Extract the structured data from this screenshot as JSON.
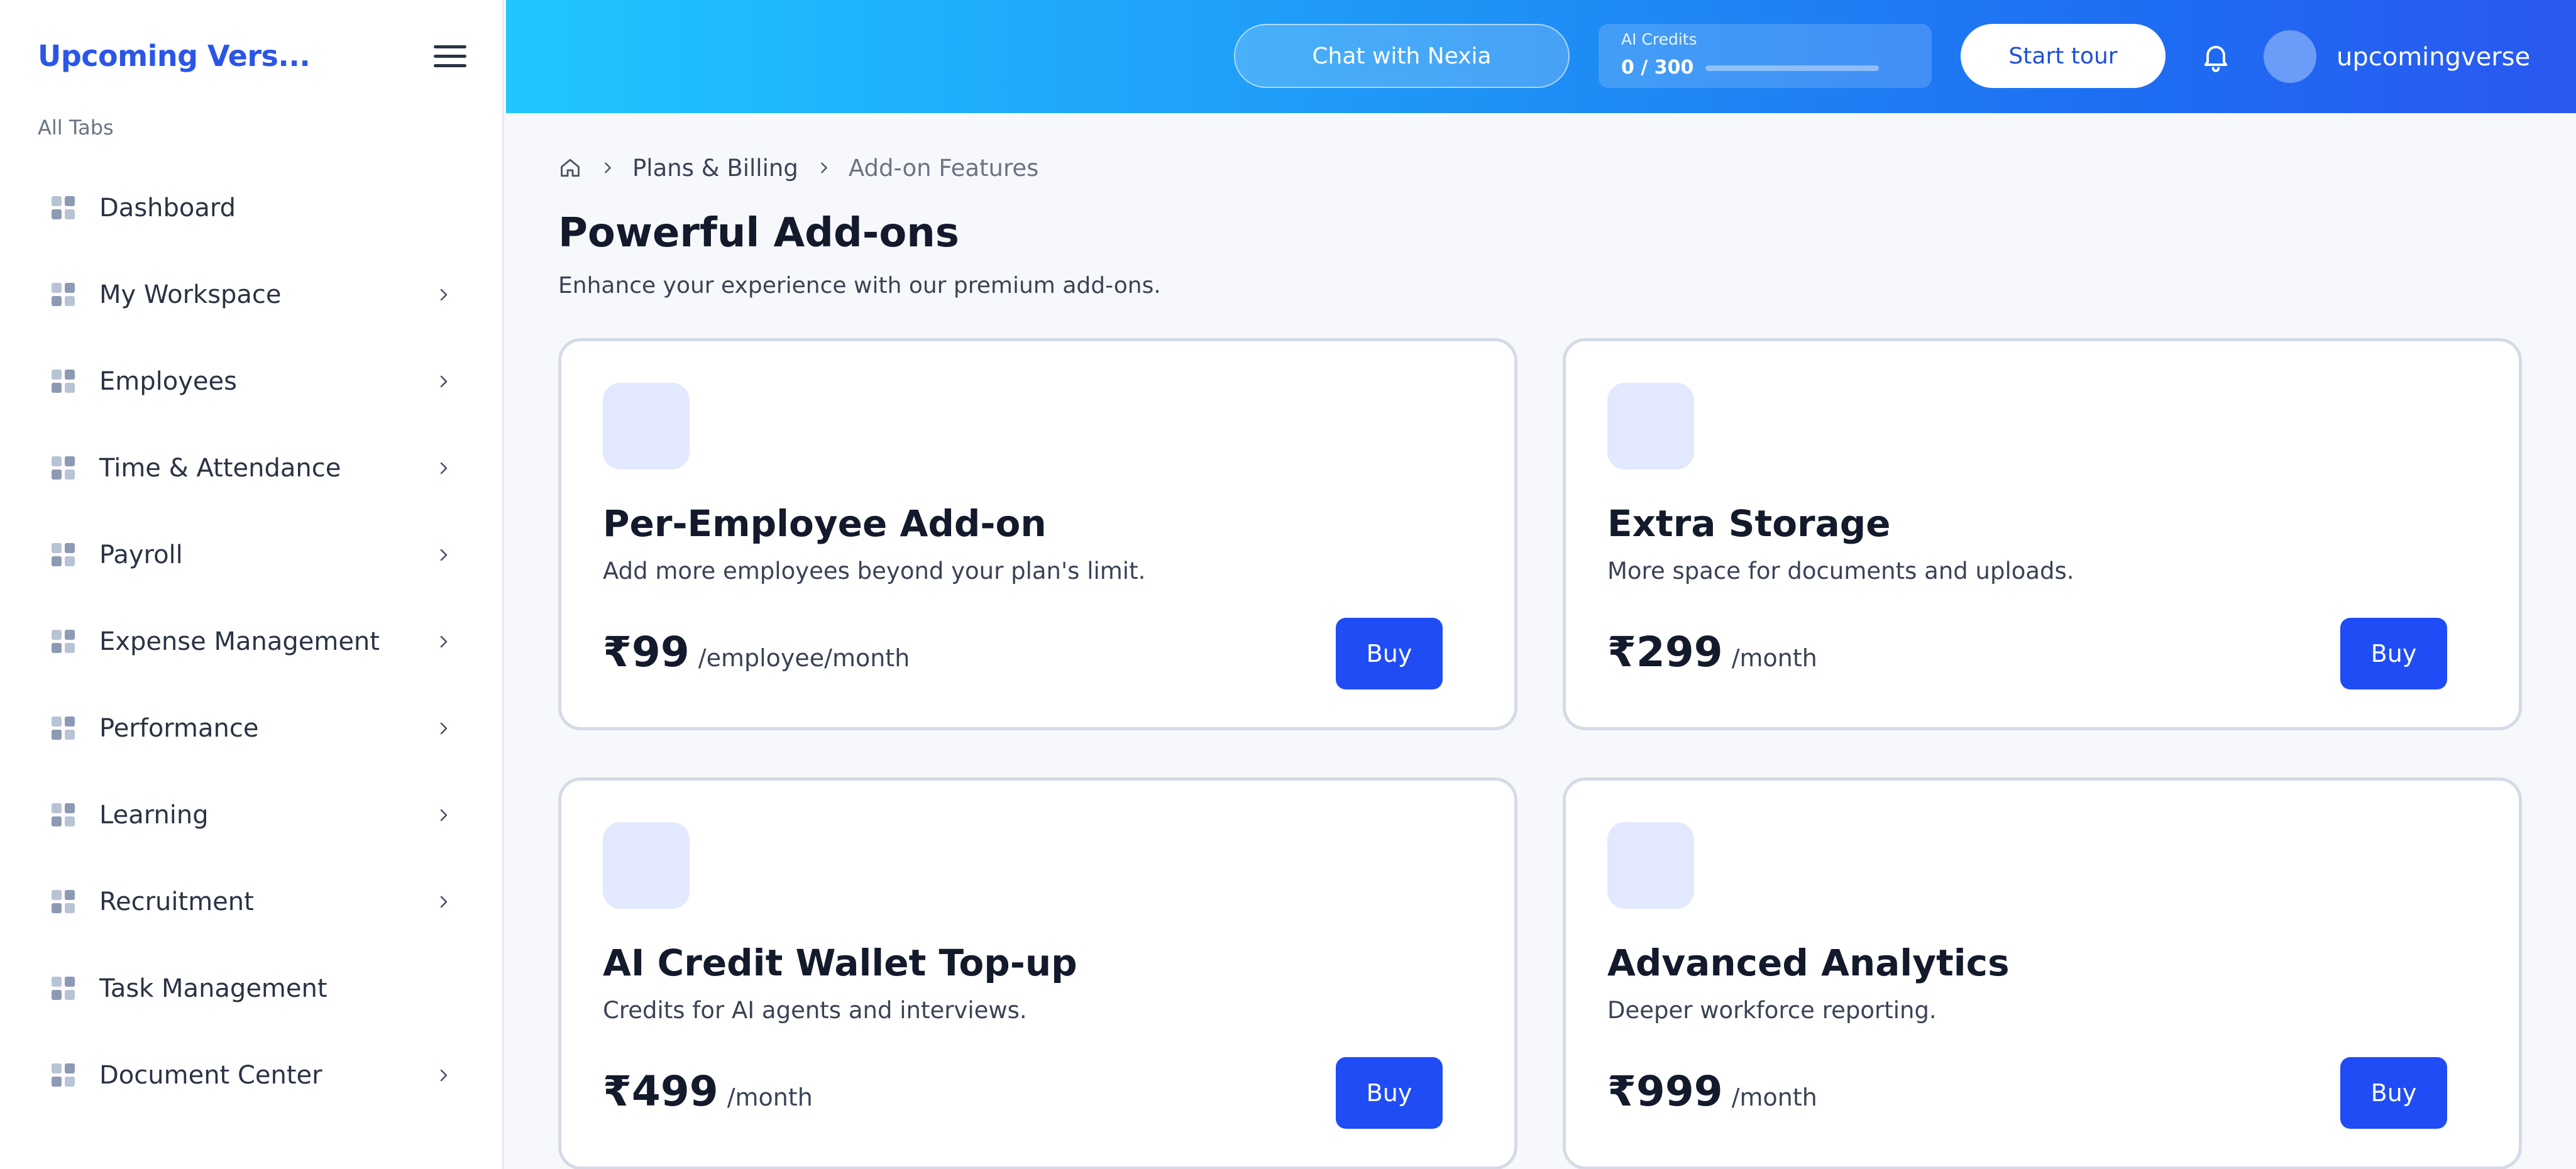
{
  "sidebar": {
    "brand": "Upcoming Vers...",
    "section_label": "All Tabs",
    "items": [
      {
        "label": "Dashboard",
        "has_children": false
      },
      {
        "label": "My Workspace",
        "has_children": true
      },
      {
        "label": "Employees",
        "has_children": true
      },
      {
        "label": "Time & Attendance",
        "has_children": true
      },
      {
        "label": "Payroll",
        "has_children": true
      },
      {
        "label": "Expense Management",
        "has_children": true
      },
      {
        "label": "Performance",
        "has_children": true
      },
      {
        "label": "Learning",
        "has_children": true
      },
      {
        "label": "Recruitment",
        "has_children": true
      },
      {
        "label": "Task Management",
        "has_children": false
      },
      {
        "label": "Document Center",
        "has_children": true
      }
    ]
  },
  "header": {
    "chat_label": "Chat with Nexia",
    "credits": {
      "title": "AI Credits",
      "value": "0 / 300",
      "used": 0,
      "total": 300
    },
    "tour_label": "Start tour",
    "username": "upcomingverse"
  },
  "breadcrumb": {
    "items": [
      {
        "label": "Plans & Billing"
      },
      {
        "label": "Add-on Features"
      }
    ]
  },
  "main": {
    "title": "Powerful Add-ons",
    "subtitle": "Enhance your experience with our premium add-ons.",
    "cards": [
      {
        "title": "Per-Employee Add-on",
        "description": "Add more employees beyond your plan's limit.",
        "price": "₹99",
        "unit": "/employee/month",
        "button": "Buy"
      },
      {
        "title": "Extra Storage",
        "description": "More space for documents and uploads.",
        "price": "₹299",
        "unit": "/month",
        "button": "Buy"
      },
      {
        "title": "AI Credit Wallet Top-up",
        "description": "Credits for AI agents and interviews.",
        "price": "₹499",
        "unit": "/month",
        "button": "Buy"
      },
      {
        "title": "Advanced Analytics",
        "description": "Deeper workforce reporting.",
        "price": "₹999",
        "unit": "/month",
        "button": "Buy"
      }
    ]
  },
  "colors": {
    "accent": "#2a56e8",
    "button": "#1f4cf5",
    "header_gradient_start": "#1fc6ff",
    "header_gradient_end": "#2a58f0"
  }
}
